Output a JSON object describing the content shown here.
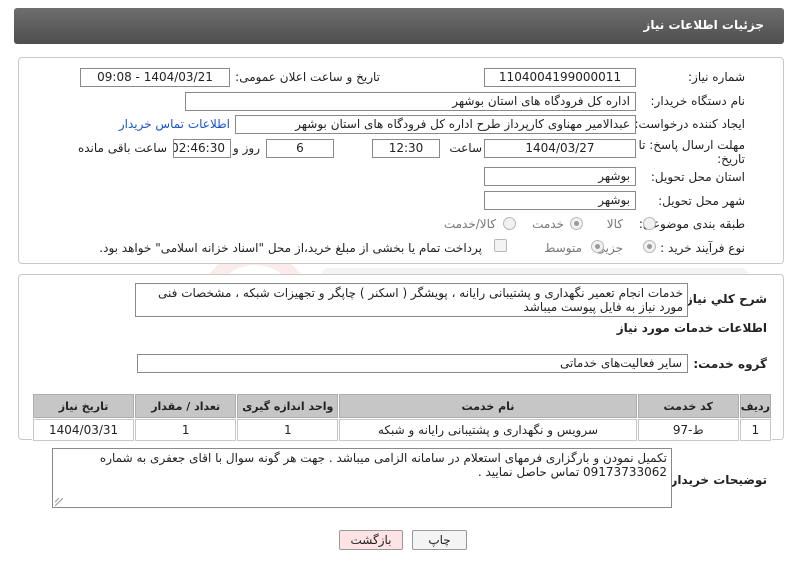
{
  "header": {
    "title": "جزئیات اطلاعات نیاز"
  },
  "need": {
    "number_label": "شماره نیاز:",
    "number": "1104004199000011",
    "announce_label": "تاریخ و ساعت اعلان عمومی:",
    "announce": "1404/03/21 - 09:08",
    "buyer_label": "نام دستگاه خریدار:",
    "buyer": "اداره کل فرودگاه های استان بوشهر",
    "creator_label": "ایجاد کننده درخواست:",
    "creator": "عبدالامیر مهناوی کارپرداز طرح اداره کل فرودگاه های استان بوشهر",
    "contact_link": "اطلاعات تماس خریدار",
    "deadline_label": "مهلت ارسال پاسخ: تا تاریخ:",
    "deadline_date": "1404/03/27",
    "hour_label": "ساعت",
    "deadline_time": "12:30",
    "days": "6",
    "days_label": "روز و",
    "remaining": "02:46:30",
    "remaining_label": "ساعت باقی مانده",
    "province_label": "استان محل تحویل:",
    "province": "بوشهر",
    "city_label": "شهر محل تحویل:",
    "city": "بوشهر",
    "category_label": "طبقه بندی موضوعی:",
    "category_options": [
      "کالا",
      "خدمت",
      "کالا/خدمت"
    ],
    "category_selected": "خدمت",
    "process_label": "نوع فرآیند خرید :",
    "process_options": [
      "جزیی",
      "متوسط"
    ],
    "process_selected": "جزیی",
    "payment_note": "پرداخت تمام یا بخشی از مبلغ خرید،از محل \"اسناد خزانه اسلامی\" خواهد بود."
  },
  "summary": {
    "label": "شرح کلي نياز:",
    "text": "خدمات انجام تعمیر نگهداری و پشتیبانی رایانه ، پویشگر ( اسکنر ) چاپگر و تجهیزات شبکه ، مشخصات فنی مورد نیاز به فایل پیوست میباشد"
  },
  "services": {
    "section_title": "اطلاعات خدمات مورد نیاز",
    "group_label": "گروه خدمت:",
    "group": "سایر فعالیت‌های خدماتی",
    "columns": [
      "ردیف",
      "کد خدمت",
      "نام خدمت",
      "واحد اندازه گیری",
      "تعداد / مقدار",
      "تاریخ نیاز"
    ],
    "rows": [
      [
        "1",
        "ط-97",
        "سرویس و نگهداری و پشتیبانی رایانه و شبکه",
        "1",
        "1",
        "1404/03/31"
      ]
    ]
  },
  "buyer_notes": {
    "label": "توضیحات خریدار:",
    "line1": "تکمیل نمودن و بارگزاری فرمهای استعلام در سامانه الزامی میباشد . جهت هر گونه سوال با اقای جعفری به شماره",
    "line2": "09173733062 تماس حاصل نمایید ."
  },
  "buttons": {
    "print": "چاپ",
    "back": "بازگشت"
  },
  "colors": {
    "header": "#5e5e5e",
    "link": "#1a55c9",
    "table_header": "#c6c6c6",
    "back_button": "#fde3e3"
  }
}
